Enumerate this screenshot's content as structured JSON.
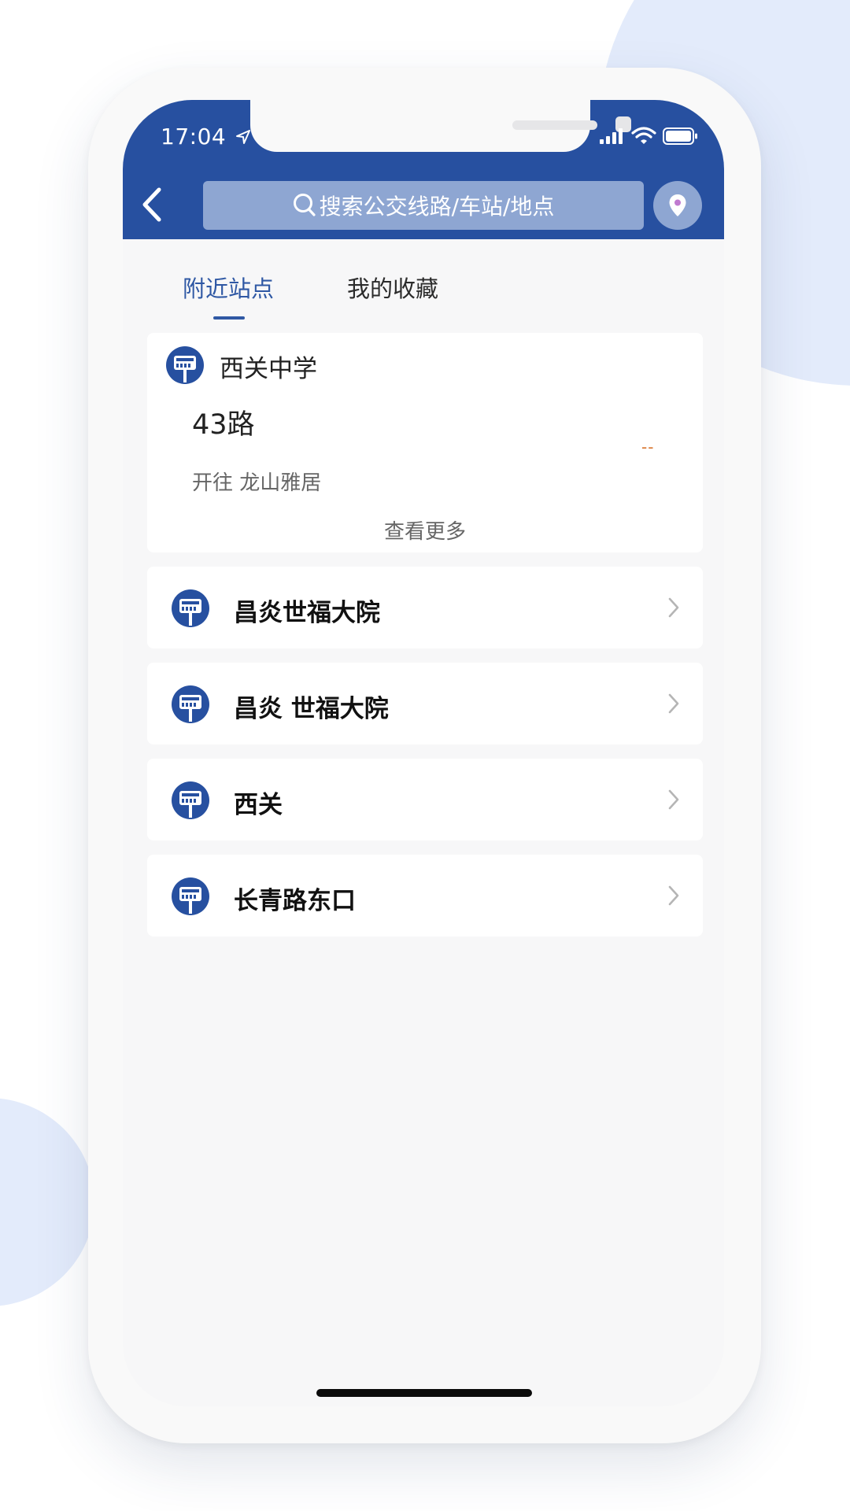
{
  "status_bar": {
    "time": "17:04"
  },
  "search": {
    "placeholder": "搜索公交线路/车站/地点"
  },
  "tabs": [
    {
      "label": "附近站点",
      "active": true
    },
    {
      "label": "我的收藏",
      "active": false
    }
  ],
  "nearby_card": {
    "stop_name": "西关中学",
    "route": "43路",
    "direction": "开往 龙山雅居",
    "eta": "--",
    "see_more": "查看更多"
  },
  "stations": [
    {
      "name": "昌炎世福大院"
    },
    {
      "name": "昌炎 世福大院"
    },
    {
      "name": "西关"
    },
    {
      "name": "长青路东口"
    }
  ],
  "colors": {
    "header": "#2750a0",
    "accent": "#2f58a4",
    "eta": "#d8742c",
    "background_blob": "#e3ebfb"
  },
  "icons": {
    "back": "chevron-left-icon",
    "search": "search-icon",
    "location": "location-pin-icon",
    "stop": "bus-stop-icon",
    "row_arrow": "chevron-right-icon"
  }
}
